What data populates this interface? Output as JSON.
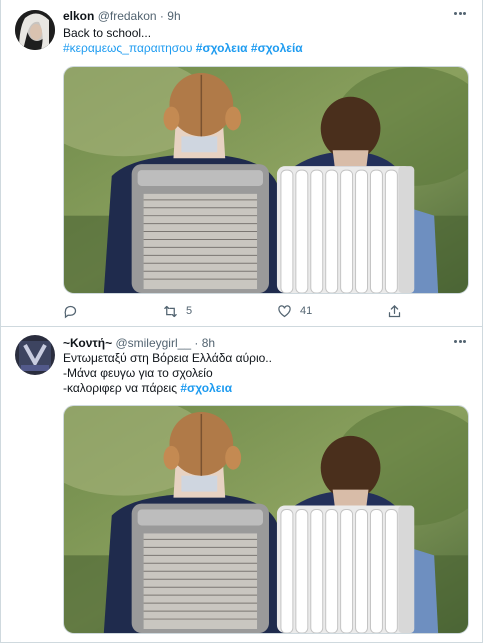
{
  "tweets": [
    {
      "name": "elkon",
      "handle": "@fredakon",
      "separator": "·",
      "time": "9h",
      "lines": [
        "Back to school..."
      ],
      "hashtags": [
        "#κεραμεως_παραιτησου",
        "#σχολεια",
        "#σχολεία"
      ],
      "replies": "",
      "retweets": "5",
      "likes": "41"
    },
    {
      "name": "~Κοντή~",
      "handle": "@smileygirl__",
      "separator": "·",
      "time": "8h",
      "lines": [
        "Εντωμεταξύ στη Βόρεια Ελλάδα αύριο..",
        "-Μάνα φευγω για το σχολείο",
        "-καλοριφερ να πάρεις"
      ],
      "hashtags": [
        "#σχολεια"
      ]
    }
  ],
  "colors": {
    "link": "#1d9bf0",
    "secondary": "#536471",
    "border": "#cfd9de"
  },
  "icons": [
    "reply-icon",
    "retweet-icon",
    "like-icon",
    "share-icon",
    "more-icon"
  ]
}
